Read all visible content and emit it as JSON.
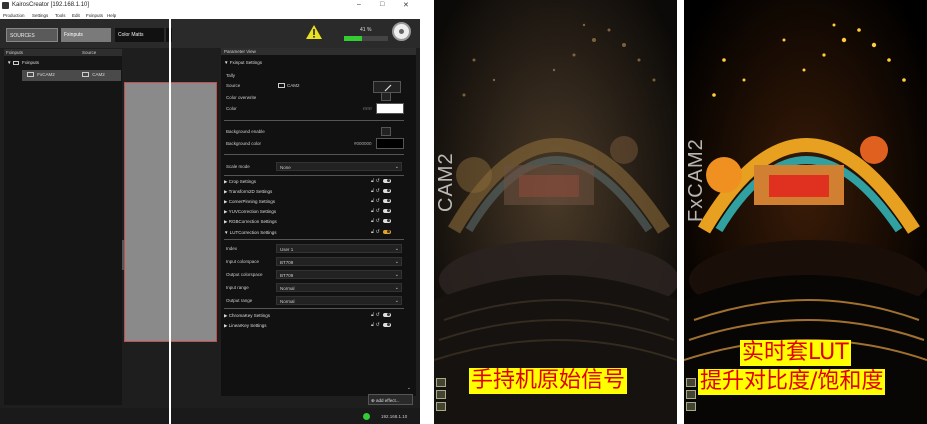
{
  "window": {
    "title": "KairosCreator [192.168.1.10]",
    "controls": [
      "–",
      "□",
      "✕"
    ]
  },
  "menu": [
    "Production",
    "Settings",
    "Tools",
    "Edit",
    "Fxinputs",
    "Help"
  ],
  "toolbar": {
    "tabs": [
      "SOURCES",
      "Fxinputs",
      "Color Matts"
    ],
    "warning_icon": "warning-triangle-icon",
    "progress_label": "41 %",
    "progress_value": 0.41,
    "colors": {
      "warning": "#e8e020",
      "progress": "#33cc33",
      "accent": "#e8a020"
    }
  },
  "left_panel": {
    "headers": [
      "Fxinputs",
      "Source"
    ],
    "root": "Fxinputs",
    "item": {
      "name": "FxCAM2",
      "source": "CAM2"
    }
  },
  "parameter_view": {
    "title": "Parameter View",
    "fxinput_section": "Fxinput Settings",
    "tally_label": "Tally",
    "source_label": "Source",
    "source_value": "CAM2",
    "color_override_label": "Color overwrite",
    "color_label": "Color",
    "color_value": "rrrrrr",
    "bg_enable_label": "Background enable",
    "bg_color_label": "Background color",
    "bg_color_value": "#000000",
    "scale_mode_label": "Scale mode",
    "scale_mode_value": "None",
    "sections": [
      "Crop Settings",
      "Transform2D Settings",
      "CornerPinning Settings",
      "YUVCorrection Settings",
      "RGBCorrection Settings",
      "LUTCorrection Settings"
    ],
    "lut": {
      "index_label": "Index",
      "index_value": "User 1",
      "input_cs_label": "Input colorspace",
      "input_cs_value": "BT709",
      "output_cs_label": "Output colorspace",
      "output_cs_value": "BT709",
      "input_range_label": "Input range",
      "input_range_value": "Normal",
      "output_range_label": "Output range",
      "output_range_value": "Normal"
    },
    "sections_after": [
      "ChromaKey Settings",
      "LinearKey Settings"
    ],
    "add_effect": "add effect..."
  },
  "status": {
    "ip": "192.168.1.10"
  },
  "photos": {
    "left": {
      "cam_label": "CAM2",
      "caption": "手持机原始信号"
    },
    "right": {
      "cam_label": "FxCAM2",
      "caption_line1": "实时套LUT",
      "caption_line2": "提升对比度/饱和度"
    }
  }
}
